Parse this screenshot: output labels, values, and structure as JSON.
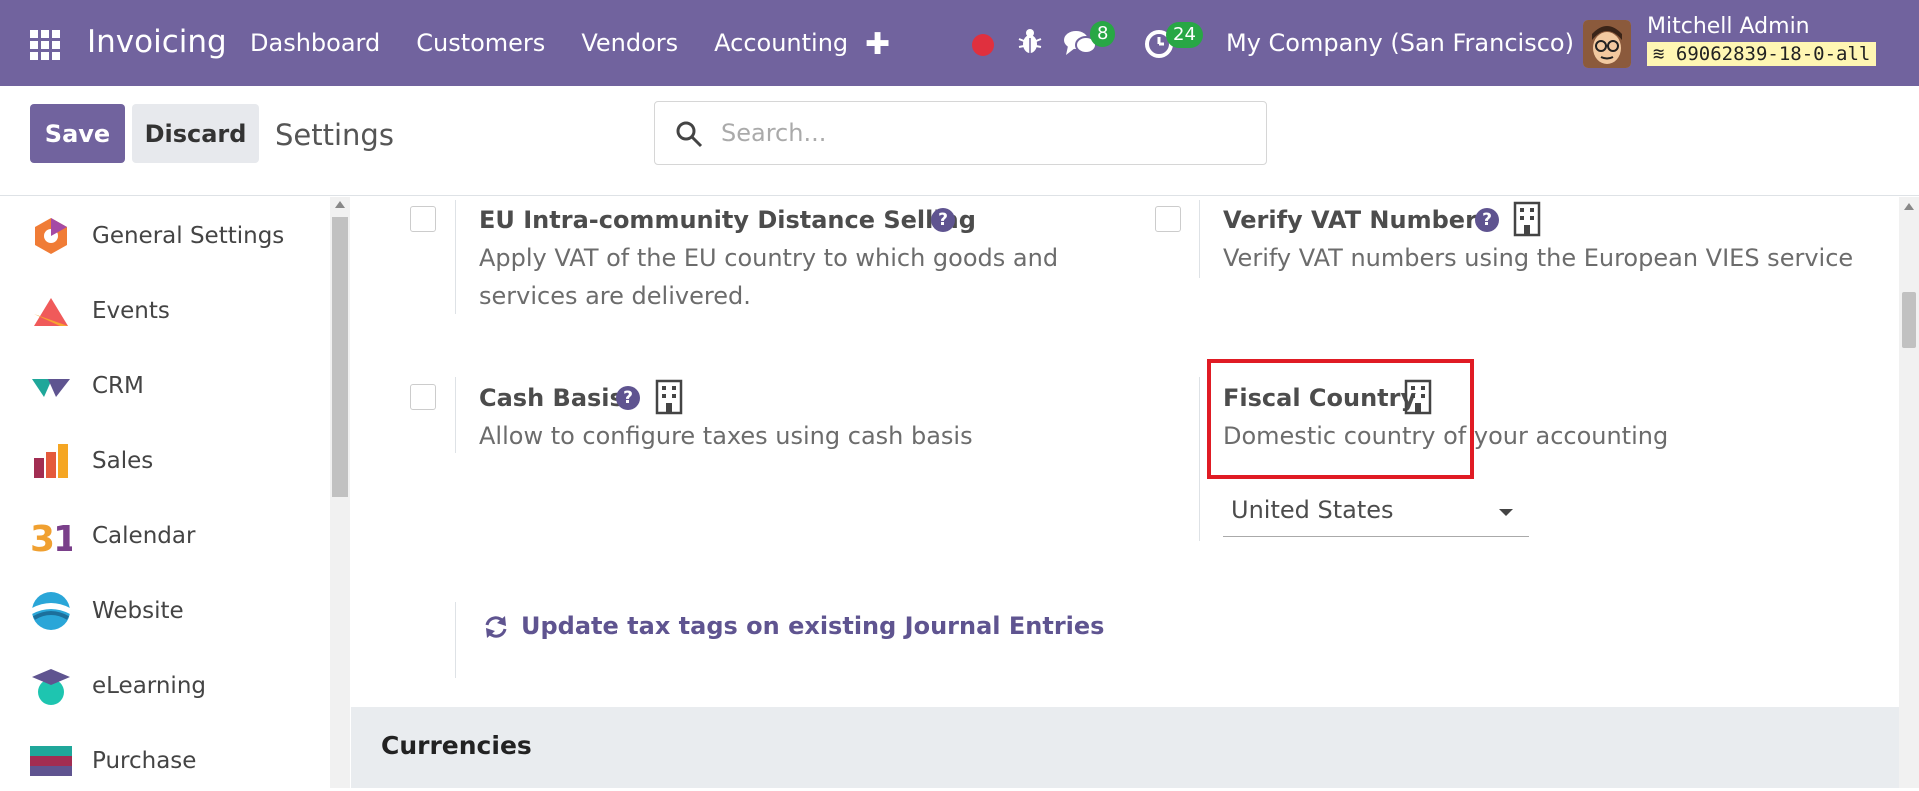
{
  "navbar": {
    "brand": "Invoicing",
    "menu": [
      "Dashboard",
      "Customers",
      "Vendors",
      "Accounting"
    ],
    "chat_count": "8",
    "activity_count": "24",
    "company": "My Company (San Francisco)",
    "user_name": "Mitchell Admin",
    "db_name": "69062839-18-0-all",
    "color": "#71639e"
  },
  "control": {
    "save_label": "Save",
    "discard_label": "Discard",
    "title": "Settings",
    "search_placeholder": "Search..."
  },
  "sidebar": {
    "items": [
      {
        "label": "General Settings",
        "icon": "general-settings-icon"
      },
      {
        "label": "Events",
        "icon": "events-icon"
      },
      {
        "label": "CRM",
        "icon": "crm-icon"
      },
      {
        "label": "Sales",
        "icon": "sales-icon"
      },
      {
        "label": "Calendar",
        "icon": "calendar-icon"
      },
      {
        "label": "Website",
        "icon": "website-icon"
      },
      {
        "label": "eLearning",
        "icon": "elearning-icon"
      },
      {
        "label": "Purchase",
        "icon": "purchase-icon"
      }
    ]
  },
  "settings": {
    "eu_title": "EU Intra-community Distance Selling",
    "eu_desc_1": "Apply VAT of the EU country to which goods and",
    "eu_desc_2": "services are delivered.",
    "vat_title": "Verify VAT Numbers",
    "vat_desc": "Verify VAT numbers using the European VIES service",
    "cash_title": "Cash Basis",
    "cash_desc": "Allow to configure taxes using cash basis",
    "fiscal_title": "Fiscal Country",
    "fiscal_desc": "Domestic country of your accounting",
    "fiscal_value": "United States",
    "update_link": "Update tax tags on existing Journal Entries",
    "help_glyph": "?"
  },
  "section": {
    "title": "Currencies"
  }
}
